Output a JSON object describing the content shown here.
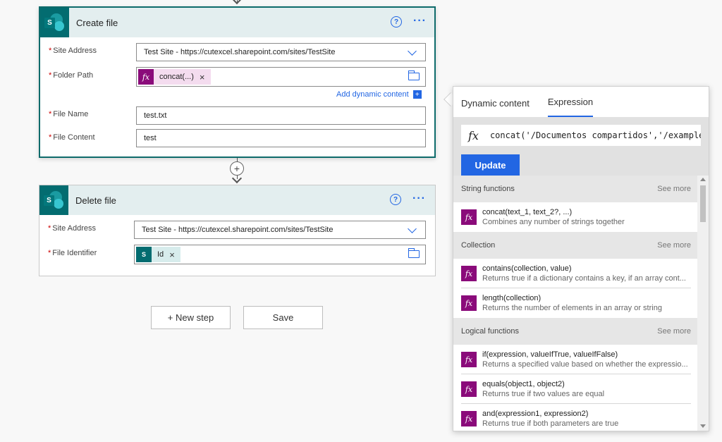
{
  "create_file": {
    "title": "Create file",
    "help_glyph": "?",
    "more_glyph": "···",
    "site_address_label": "Site Address",
    "site_address_value": "Test Site - https://cutexcel.sharepoint.com/sites/TestSite",
    "folder_path_label": "Folder Path",
    "folder_token_label": "concat(...)",
    "add_dynamic_label": "Add dynamic content",
    "file_name_label": "File Name",
    "file_name_value": "test.txt",
    "file_content_label": "File Content",
    "file_content_value": "test"
  },
  "delete_file": {
    "title": "Delete file",
    "help_glyph": "?",
    "more_glyph": "···",
    "site_address_label": "Site Address",
    "site_address_value": "Test Site - https://cutexcel.sharepoint.com/sites/TestSite",
    "file_identifier_label": "File Identifier",
    "file_identifier_token": "Id"
  },
  "required_marker": "*",
  "token_close": "×",
  "fx_glyph": "fx",
  "sp_glyph": "S",
  "actions": {
    "new_step_label": "+ New step",
    "save_label": "Save"
  },
  "panel": {
    "tabs": [
      "Dynamic content",
      "Expression"
    ],
    "active_tab": "Expression",
    "expression_text": "concat('/Documentos compartidos','/example",
    "update_label": "Update",
    "sections": [
      {
        "name": "String functions",
        "see_more": "See more",
        "items": [
          {
            "signature": "concat(text_1, text_2?, ...)",
            "description": "Combines any number of strings together"
          }
        ]
      },
      {
        "name": "Collection",
        "see_more": "See more",
        "items": [
          {
            "signature": "contains(collection, value)",
            "description": "Returns true if a dictionary contains a key, if an array cont..."
          },
          {
            "signature": "length(collection)",
            "description": "Returns the number of elements in an array or string"
          }
        ]
      },
      {
        "name": "Logical functions",
        "see_more": "See more",
        "items": [
          {
            "signature": "if(expression, valueIfTrue, valueIfFalse)",
            "description": "Returns a specified value based on whether the expressio..."
          },
          {
            "signature": "equals(object1, object2)",
            "description": "Returns true if two values are equal"
          },
          {
            "signature": "and(expression1, expression2)",
            "description": "Returns true if both parameters are true"
          }
        ]
      }
    ]
  }
}
